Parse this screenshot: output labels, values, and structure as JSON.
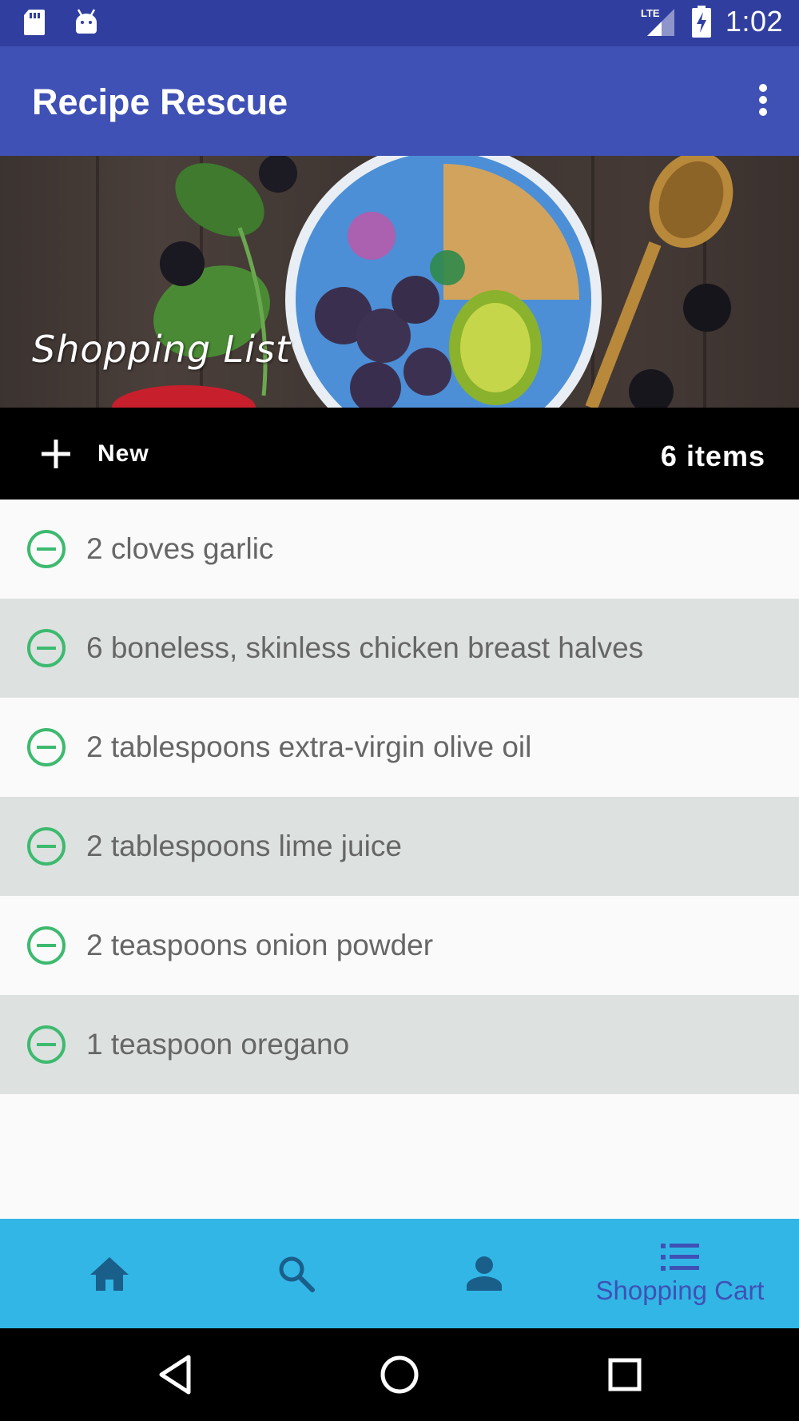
{
  "status_bar": {
    "network": "LTE",
    "time": "1:02",
    "icons": [
      "sd-card-icon",
      "android-icon",
      "signal-icon",
      "battery-charging-icon"
    ]
  },
  "app_bar": {
    "title": "Recipe Rescue",
    "menu_icon": "more-vert-icon"
  },
  "hero": {
    "title": "Shopping List"
  },
  "action_bar": {
    "new_label": "New",
    "items_count": "6 items"
  },
  "shopping_list": [
    {
      "text": "2 cloves garlic"
    },
    {
      "text": "6 boneless, skinless chicken breast halves"
    },
    {
      "text": "2 tablespoons extra-virgin olive oil"
    },
    {
      "text": "2 tablespoons lime juice"
    },
    {
      "text": "2 teaspoons onion powder"
    },
    {
      "text": "1 teaspoon oregano"
    }
  ],
  "bottom_nav": {
    "items": [
      {
        "icon": "home-icon",
        "label": ""
      },
      {
        "icon": "search-icon",
        "label": ""
      },
      {
        "icon": "person-icon",
        "label": ""
      },
      {
        "icon": "list-icon",
        "label": "Shopping Cart",
        "active": true
      }
    ]
  },
  "colors": {
    "status_bar": "#303f9f",
    "app_bar": "#3f51b5",
    "bottom_nav": "#32b6e6",
    "remove_icon": "#3dba6f",
    "row_alt": "#dde1e0"
  }
}
